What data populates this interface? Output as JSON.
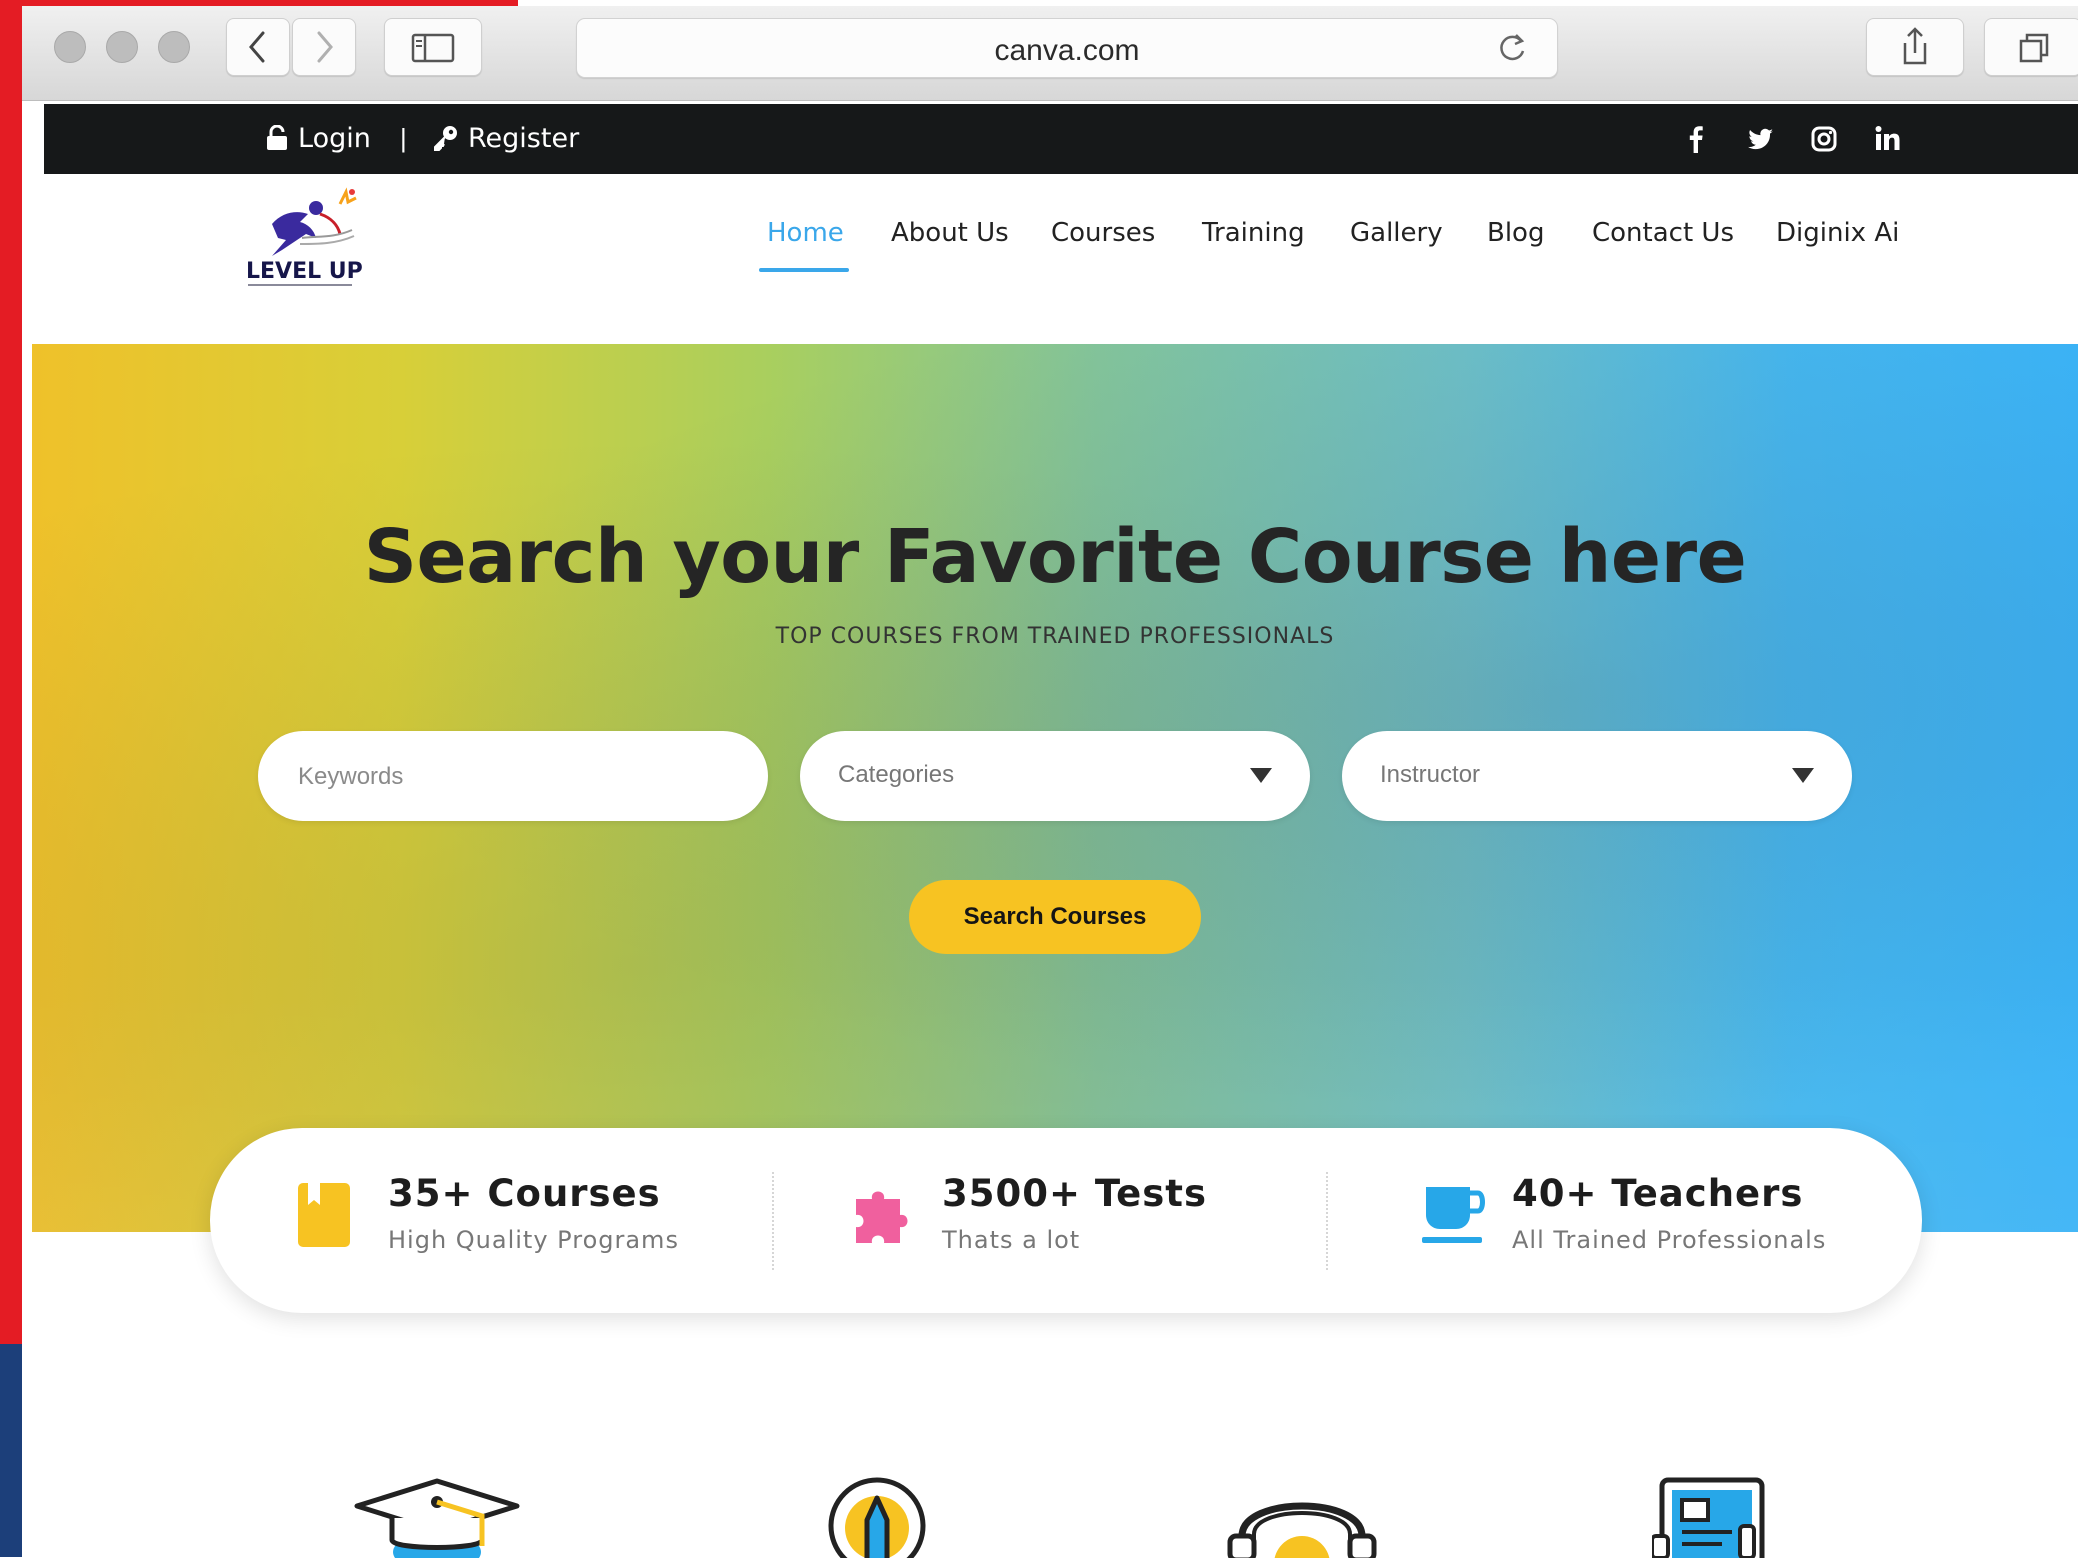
{
  "browser": {
    "url": "canva.com",
    "icons": [
      "back-icon",
      "forward-icon",
      "sidebar-icon",
      "reload-icon",
      "share-icon",
      "tabs-icon"
    ]
  },
  "topbar": {
    "login_label": "Login",
    "separator": "|",
    "register_label": "Register",
    "social": [
      "facebook-icon",
      "twitter-icon",
      "instagram-icon",
      "linkedin-icon"
    ]
  },
  "logo": {
    "text": "LEVEL UP"
  },
  "nav": {
    "items": [
      {
        "label": "Home",
        "active": true
      },
      {
        "label": "About Us"
      },
      {
        "label": "Courses"
      },
      {
        "label": "Training"
      },
      {
        "label": "Gallery"
      },
      {
        "label": "Blog"
      },
      {
        "label": "Contact Us"
      },
      {
        "label": "Diginix Ai"
      }
    ]
  },
  "hero": {
    "title": "Search your Favorite Course here",
    "subtitle": "TOP COURSES FROM TRAINED PROFESSIONALS",
    "keywords_placeholder": "Keywords",
    "categories_value": "Categories",
    "instructor_value": "Instructor",
    "search_button": "Search Courses"
  },
  "stats": [
    {
      "title": "35+ Courses",
      "subtitle": "High Quality Programs",
      "icon": "book-icon",
      "color": "#f7c322"
    },
    {
      "title": "3500+ Tests",
      "subtitle": "Thats a lot",
      "icon": "puzzle-icon",
      "color": "#f0609e"
    },
    {
      "title": "40+ Teachers",
      "subtitle": "All Trained Professionals",
      "icon": "cup-icon",
      "color": "#27a7e8"
    }
  ],
  "features": [
    "graduation-cap-icon",
    "pencil-bulb-icon",
    "headphones-icon",
    "tablet-icon"
  ],
  "colors": {
    "accent": "#3aa7ea",
    "button": "#f7c322",
    "topbar": "#161819"
  }
}
